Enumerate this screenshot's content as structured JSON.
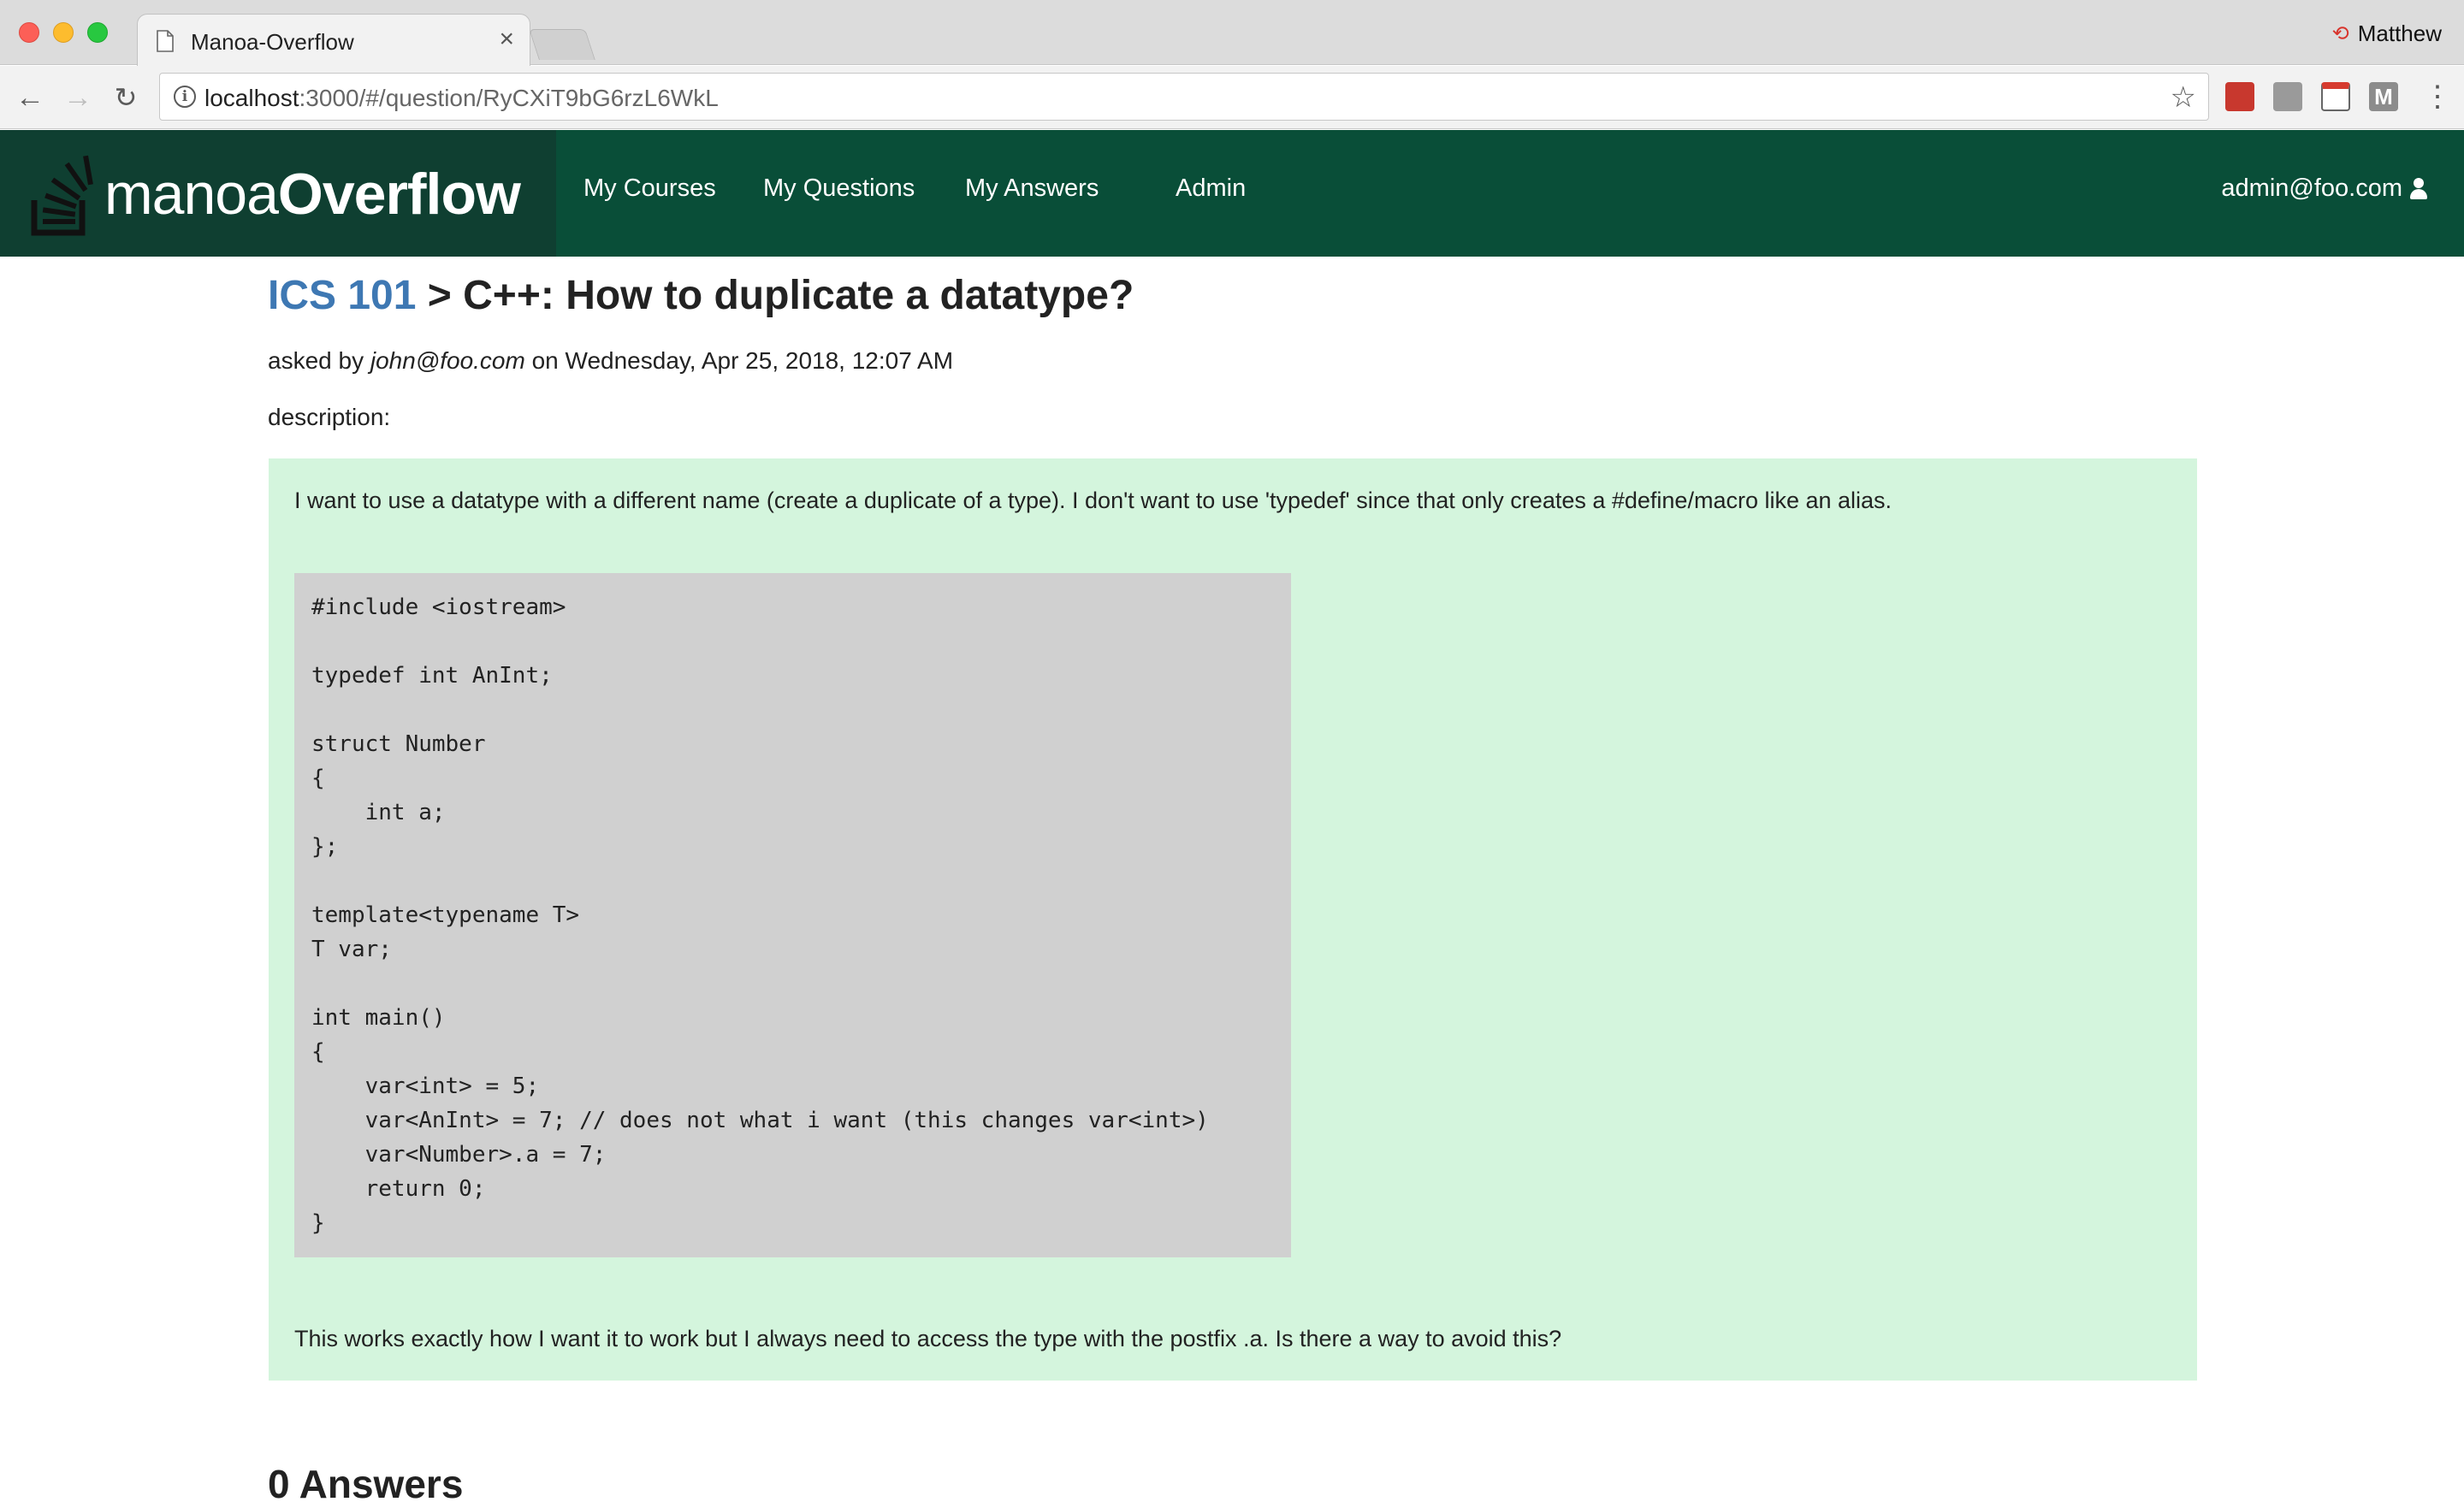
{
  "browser": {
    "tab_title": "Manoa-Overflow",
    "tab_close": "×",
    "profile_name": "Matthew",
    "url_host": "localhost",
    "url_path": ":3000/#/question/RyCXiT9bG6rzL6WkL"
  },
  "navbar": {
    "brand_light": "manoa",
    "brand_bold": "Overflow",
    "items": [
      {
        "label": "My Courses"
      },
      {
        "label": "My Questions"
      },
      {
        "label": "My Answers"
      },
      {
        "label": "Admin"
      }
    ],
    "user_email": "admin@foo.com"
  },
  "question": {
    "course": "ICS 101",
    "separator": " > ",
    "title": "C++: How to duplicate a datatype?",
    "asked_prefix": "asked by ",
    "author": "john@foo.com",
    "date_text": " on Wednesday, Apr 25, 2018, 12:07 AM",
    "description_label": "description:",
    "paragraph_1": "I want to use a datatype with a different name (create a duplicate of a type). I don't want to use 'typedef' since that only creates a #define/macro like an alias.",
    "code": "#include <iostream>\n\ntypedef int AnInt;\n\nstruct Number\n{\n    int a;\n};\n\ntemplate<typename T>\nT var;\n\nint main()\n{\n    var<int> = 5;\n    var<AnInt> = 7; // does not what i want (this changes var<int>)\n    var<Number>.a = 7;\n    return 0;\n}",
    "paragraph_2": "This works exactly how I want it to work but I always need to access the type with the postfix .a. Is there a way to avoid this?"
  },
  "answers": {
    "heading": "0 Answers"
  },
  "colors": {
    "navbar_bg": "#094e38",
    "brand_bg": "#0f3f31",
    "course_link": "#3e78b3",
    "description_bg": "#d4f5dd",
    "code_bg": "#d0d0d0"
  }
}
